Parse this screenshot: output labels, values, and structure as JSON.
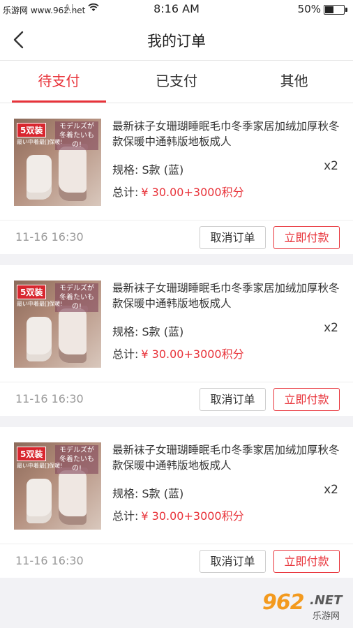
{
  "status_bar": {
    "watermark": "乐游网 www.962.net",
    "carrier": "AL",
    "time": "8:16 AM",
    "battery_pct": "50%",
    "battery_level": 0.5
  },
  "nav": {
    "title": "我的订单"
  },
  "tabs": [
    {
      "label": "待支付",
      "active": true
    },
    {
      "label": "已支付",
      "active": false
    },
    {
      "label": "其他",
      "active": false
    }
  ],
  "orders": [
    {
      "thumb_badge": "5双装",
      "thumb_text": "モデルズが 冬着たいもの!",
      "thumb_sub": "最い中着最[]保暖!",
      "name": "最新袜子女珊瑚睡眠毛巾冬季家居加绒加厚秋冬款保暖中通韩版地板成人",
      "spec": "规格:  S款 (蓝)",
      "qty": "x2",
      "total_label": "总计:",
      "price": "¥ 30.00+3000积分",
      "time": "11-16 16:30",
      "cancel_label": "取消订单",
      "pay_label": "立即付款"
    },
    {
      "thumb_badge": "5双装",
      "thumb_text": "モデルズが 冬着たいもの!",
      "thumb_sub": "最い中着最[]保暖!",
      "name": "最新袜子女珊瑚睡眠毛巾冬季家居加绒加厚秋冬款保暖中通韩版地板成人",
      "spec": "规格:  S款 (蓝)",
      "qty": "x2",
      "total_label": "总计:",
      "price": "¥ 30.00+3000积分",
      "time": "11-16 16:30",
      "cancel_label": "取消订单",
      "pay_label": "立即付款"
    },
    {
      "thumb_badge": "5双装",
      "thumb_text": "モデルズが 冬着たいもの!",
      "thumb_sub": "最い中着最[]保暖!",
      "name": "最新袜子女珊瑚睡眠毛巾冬季家居加绒加厚秋冬款保暖中通韩版地板成人",
      "spec": "规格:  S款 (蓝)",
      "qty": "x2",
      "total_label": "总计:",
      "price": "¥ 30.00+3000积分",
      "time": "11-16 16:30",
      "cancel_label": "取消订单",
      "pay_label": "立即付款"
    }
  ],
  "logo": {
    "number": "962",
    "suffix": ".NET",
    "name": "乐游网"
  },
  "colors": {
    "accent": "#e8333a",
    "background": "#f2f2f5"
  }
}
